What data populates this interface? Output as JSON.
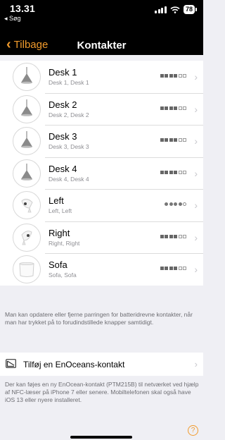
{
  "status": {
    "time": "13.31",
    "back_app": "◂ Søg",
    "battery": "78"
  },
  "nav": {
    "back_label": "Tilbage",
    "title": "Kontakter"
  },
  "items": [
    {
      "title": "Desk 1",
      "subtitle": "Desk 1, Desk 1",
      "icon": "pendant-lamp-icon",
      "indicator": "squares",
      "level": 4
    },
    {
      "title": "Desk 2",
      "subtitle": "Desk 2, Desk 2",
      "icon": "pendant-lamp-icon",
      "indicator": "squares",
      "level": 4
    },
    {
      "title": "Desk 3",
      "subtitle": "Desk 3, Desk 3",
      "icon": "pendant-lamp-icon",
      "indicator": "squares",
      "level": 4
    },
    {
      "title": "Desk 4",
      "subtitle": "Desk 4, Desk 4",
      "icon": "pendant-lamp-icon",
      "indicator": "squares",
      "level": 4
    },
    {
      "title": "Left",
      "subtitle": "Left, Left",
      "icon": "spot-lamp-icon",
      "indicator": "dots",
      "level": 4
    },
    {
      "title": "Right",
      "subtitle": "Right, Right",
      "icon": "spot-lamp-icon",
      "indicator": "squares",
      "level": 4
    },
    {
      "title": "Sofa",
      "subtitle": "Sofa, Sofa",
      "icon": "shade-lamp-icon",
      "indicator": "squares",
      "level": 4
    }
  ],
  "info_pairing": "Man kan opdatere eller fjerne parringen for batteridrevne kontakter, når man har trykket på to forudindstillede knapper samtidigt.",
  "add_contact_label": "Tilføj en EnOceans-kontakt",
  "info_nfc": "Der kan føjes en ny EnOcean-kontakt (PTM215B) til netværket ved hjælp af NFC-læser på iPhone 7 eller senere. Mobiltelefonen skal også have iOS 13 eller nyere installeret.",
  "help_label": "?",
  "colors": {
    "accent": "#f19b2c",
    "header_bg": "#000000",
    "background": "#efeff4"
  }
}
